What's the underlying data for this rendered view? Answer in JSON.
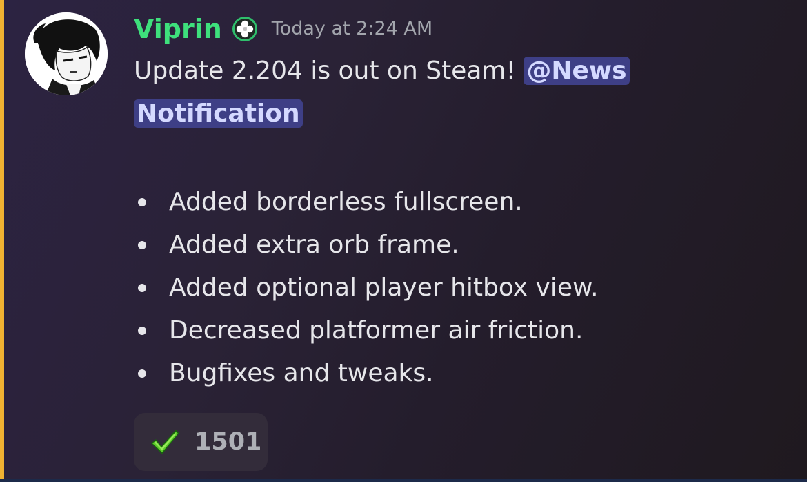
{
  "message": {
    "author": "Viprin",
    "timestamp": "Today at 2:24 AM",
    "text_before_mention": "Update 2.204 is out on Steam! ",
    "mention": "@News Notification",
    "bullets": [
      "Added borderless fullscreen.",
      "Added extra orb frame.",
      "Added optional player hitbox view.",
      "Decreased platformer air friction.",
      "Bugfixes and tweaks."
    ],
    "reaction": {
      "emoji": "check-mark-icon",
      "count": "1501"
    }
  },
  "colors": {
    "username": "#3ee07c",
    "mention_bg": "#3e3f86",
    "mention_text": "#d4d9ff",
    "mention_accent_bar": "#f0b232"
  }
}
